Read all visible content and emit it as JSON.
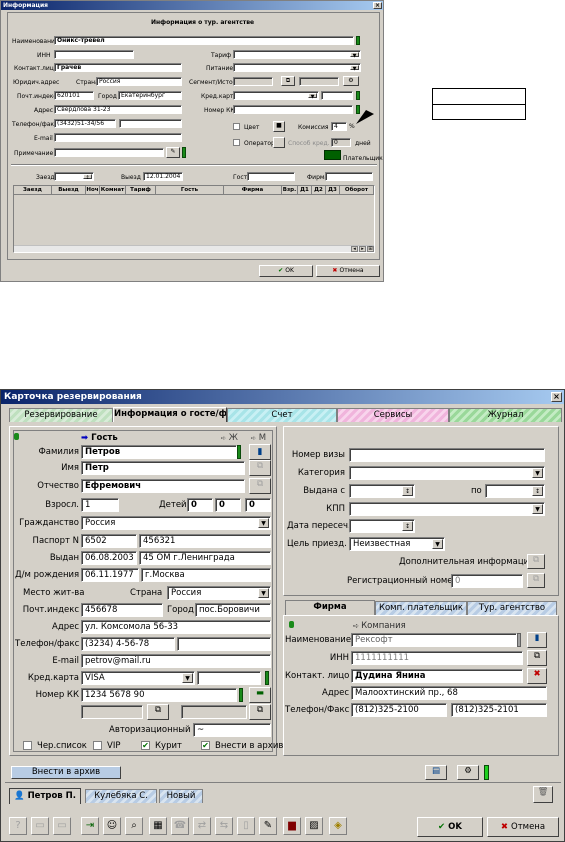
{
  "w1": {
    "title": "Информация",
    "heading": "Информация о тур. агентстве",
    "name_label": "Наименование",
    "name_value": "Оникс-тревел",
    "inn_label": "ИНН",
    "contact_label": "Контакт.лицо",
    "contact_value": "Грачев",
    "legal_label": "Юридич.адрес",
    "country_label": "Страна",
    "country_value": "Россия",
    "zip_label": "Почт.индекс",
    "zip_value": "620101",
    "city_label": "Город",
    "city_value": "Екатеринбург",
    "addr_label": "Адрес",
    "addr_value": "Свердлова 31-23",
    "phone_label": "Телефон/факс",
    "phone_value": "(3432)51-34/56",
    "email_label": "E-mail",
    "note_label": "Примечание",
    "tariff_label": "Тариф",
    "food_label": "Питание",
    "segment_label": "Сегмент/Источ.",
    "card_label": "Кред.карта",
    "cc_label": "Номер КК",
    "color_label": "Цвет",
    "commission_label": "Комиссия",
    "commission_value": "4",
    "percent": "%",
    "operator_label": "Оператор",
    "payterm_label": "Способ кред. опл.",
    "payterm_value": "0",
    "days_label": "дней",
    "payer_label": "Плательщик",
    "arrival_label": "Заезд",
    "departure_label": "Выезд",
    "departure_value": "12.01.2004",
    "guest_label": "Гость",
    "firm_label": "Фирма",
    "columns": [
      "Заезд",
      "Выезд",
      "Ноч",
      "Комнат",
      "Тариф",
      "Гость",
      "Фирма",
      "Взр.",
      "Д1",
      "Д2",
      "Д3",
      "Оборот"
    ],
    "ok": "OK",
    "cancel": "Отмена"
  },
  "w2": {
    "title": "Карточка резервирования",
    "tabs": [
      "Резервирование",
      "Информация о госте/фи",
      "Счет",
      "Сервисы",
      "Журнал"
    ],
    "guest_header": "Гость",
    "zh": "Ж",
    "m": "М",
    "surname_label": "Фамилия",
    "surname": "Петров",
    "name_label": "Имя",
    "name": "Петр",
    "patronymic_label": "Отчество",
    "patronymic": "Ефремович",
    "adults_label": "Взросл.",
    "adults": "1",
    "children_label": "Детей",
    "c1": "0",
    "c2": "0",
    "c3": "0",
    "citizenship_label": "Гражданство",
    "citizenship": "Россия",
    "passport_label": "Паспорт N",
    "pass_series": "6502",
    "pass_number": "456321",
    "issued_label": "Выдан",
    "issued_date": "06.08.2003",
    "issued_by": "45 ОМ г.Ленинграда",
    "birth_label": "Д/м рождения",
    "birth_date": "06.11.1977",
    "birth_place": "г.Москва",
    "residence_label": "Место жит-ва",
    "country_label": "Страна",
    "country": "Россия",
    "zip_label": "Почт.индекс",
    "zip": "456678",
    "city_label": "Город",
    "city": "пос.Боровичи",
    "address_label": "Адрес",
    "address": "ул. Комсомола 56-33",
    "phone_label": "Телефон/факс",
    "phone": "(3234) 4-56-78",
    "email_label": "E-mail",
    "email": "petrov@mail.ru",
    "card_label": "Кред.карта",
    "card": "VISA",
    "cc_label": "Номер КК",
    "cc": "1234 5678 90",
    "auth_label": "Авторизационный",
    "auth": "~",
    "blacklist_label": "Чер.список",
    "vip_label": "VIP",
    "smoker_label": "Курит",
    "archive_label": "Внести в архив",
    "visa_label": "Номер визы",
    "category_label": "Категория",
    "issued_from_label": "Выдана с",
    "to_label": "по",
    "kpp_label": "КПП",
    "cross_date_label": "Дата пересеч.",
    "purpose_label": "Цель приезд.",
    "purpose": "Неизвестная",
    "extra_info": "Дополнительная информация",
    "reg_label": "Регистрационный номер",
    "reg": "0",
    "firm_tabs": [
      "Фирма",
      "Комп. плательщик",
      "Тур. агентство"
    ],
    "company_header": "Компания",
    "f_name_label": "Наименование",
    "f_name": "Рексофт",
    "f_inn_label": "ИНН",
    "f_inn": "1111111111",
    "f_contact_label": "Контакт. лицо",
    "f_contact": "Дудина Янина",
    "f_address_label": "Адрес",
    "f_address": "Малоохтинский пр., 68",
    "f_phone_label": "Телефон/Факс",
    "f_phone": "(812)325-2100",
    "f_fax": "(812)325-2101",
    "archive_button": "Внести в архив",
    "guest_tabs": [
      "Петров П.",
      "Кулебяка С.",
      "Новый"
    ],
    "ok": "OK",
    "cancel": "Отмена"
  }
}
